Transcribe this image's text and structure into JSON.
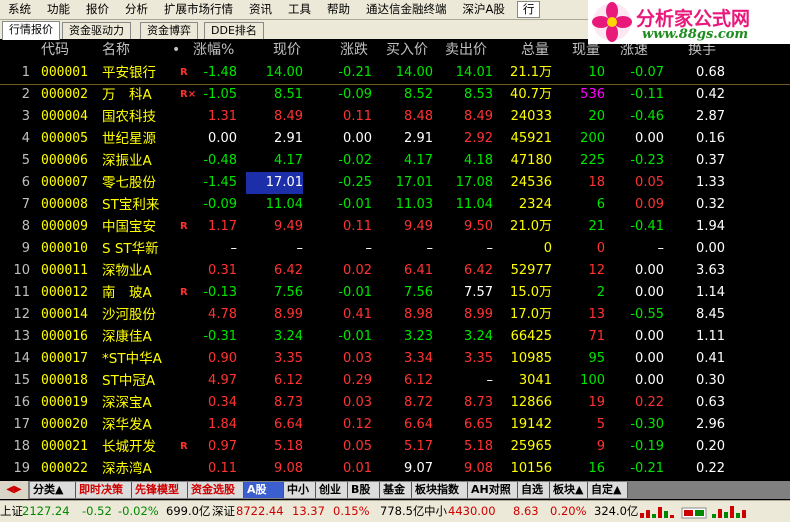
{
  "menu": {
    "items": [
      "系统",
      "功能",
      "报价",
      "分析",
      "扩展市场行情",
      "资讯",
      "工具",
      "帮助",
      "通达信金融终端",
      "深沪A股",
      "行"
    ]
  },
  "logo": {
    "brand": "分析家公式网",
    "url": "www.88gs.com"
  },
  "tabs": [
    "行情报价",
    "资金驱动力",
    "资金博弈",
    "DDE排名"
  ],
  "header": {
    "code": "代码",
    "name": "名称",
    "dot": "•",
    "pct": "涨幅%",
    "price": "现价",
    "chg": "涨跌",
    "bid": "买入价",
    "ask": "卖出价",
    "vol": "总量",
    "cur": "现量",
    "speed": "涨速",
    "turn": "换手"
  },
  "rows": [
    {
      "n": "1",
      "code": "000001",
      "name": "平安银行",
      "flag": "R",
      "pct": "-1.48",
      "price": "14.00",
      "chg": "-0.21",
      "bid": "14.00",
      "ask": "14.01",
      "vol": "21.1万",
      "cur": "10",
      "speed": "-0.07",
      "turn": "0.68",
      "pc": "green",
      "prc": "green",
      "bc": "green",
      "ac": "green",
      "cc": "green",
      "sc": "green"
    },
    {
      "n": "2",
      "code": "000002",
      "name": "万　科A",
      "flag": "R×",
      "pct": "-1.05",
      "price": "8.51",
      "chg": "-0.09",
      "bid": "8.52",
      "ask": "8.53",
      "vol": "40.7万",
      "cur": "536",
      "speed": "-0.11",
      "turn": "0.42",
      "pc": "green",
      "prc": "green",
      "bc": "green",
      "ac": "green",
      "cc": "magenta",
      "sc": "green"
    },
    {
      "n": "3",
      "code": "000004",
      "name": "国农科技",
      "flag": "",
      "pct": "1.31",
      "price": "8.49",
      "chg": "0.11",
      "bid": "8.48",
      "ask": "8.49",
      "vol": "24033",
      "cur": "20",
      "speed": "-0.46",
      "turn": "2.87",
      "pc": "red",
      "prc": "red",
      "bc": "red",
      "ac": "red",
      "cc": "green",
      "sc": "green"
    },
    {
      "n": "4",
      "code": "000005",
      "name": "世纪星源",
      "flag": "",
      "pct": "0.00",
      "price": "2.91",
      "chg": "0.00",
      "bid": "2.91",
      "ask": "2.92",
      "vol": "45921",
      "cur": "200",
      "speed": "0.00",
      "turn": "0.16",
      "pc": "white",
      "prc": "white",
      "bc": "white",
      "ac": "red",
      "cc": "green",
      "sc": "white"
    },
    {
      "n": "5",
      "code": "000006",
      "name": "深振业A",
      "flag": "",
      "pct": "-0.48",
      "price": "4.17",
      "chg": "-0.02",
      "bid": "4.17",
      "ask": "4.18",
      "vol": "47180",
      "cur": "225",
      "speed": "-0.23",
      "turn": "0.37",
      "pc": "green",
      "prc": "green",
      "bc": "green",
      "ac": "green",
      "cc": "green",
      "sc": "green"
    },
    {
      "n": "6",
      "code": "000007",
      "name": "零七股份",
      "flag": "",
      "pct": "-1.45",
      "price": "17.01",
      "chg": "-0.25",
      "bid": "17.01",
      "ask": "17.08",
      "vol": "24536",
      "cur": "18",
      "speed": "0.05",
      "turn": "1.33",
      "pc": "green",
      "prc": "white",
      "bc": "green",
      "ac": "green",
      "cc": "red",
      "sc": "red",
      "hl": true
    },
    {
      "n": "7",
      "code": "000008",
      "name": "ST宝利来",
      "flag": "",
      "pct": "-0.09",
      "price": "11.04",
      "chg": "-0.01",
      "bid": "11.03",
      "ask": "11.04",
      "vol": "2324",
      "cur": "6",
      "speed": "0.09",
      "turn": "0.32",
      "pc": "green",
      "prc": "green",
      "bc": "green",
      "ac": "green",
      "cc": "green",
      "sc": "red"
    },
    {
      "n": "8",
      "code": "000009",
      "name": "中国宝安",
      "flag": "R",
      "pct": "1.17",
      "price": "9.49",
      "chg": "0.11",
      "bid": "9.49",
      "ask": "9.50",
      "vol": "21.0万",
      "cur": "21",
      "speed": "-0.41",
      "turn": "1.94",
      "pc": "red",
      "prc": "red",
      "bc": "red",
      "ac": "red",
      "cc": "green",
      "sc": "green"
    },
    {
      "n": "9",
      "code": "000010",
      "name": "S ST华新",
      "flag": "",
      "pct": "–",
      "price": "–",
      "chg": "–",
      "bid": "–",
      "ask": "–",
      "vol": "0",
      "cur": "0",
      "speed": "–",
      "turn": "0.00",
      "pc": "white",
      "prc": "white",
      "bc": "white",
      "ac": "white",
      "cc": "red",
      "sc": "white"
    },
    {
      "n": "10",
      "code": "000011",
      "name": "深物业A",
      "flag": "",
      "pct": "0.31",
      "price": "6.42",
      "chg": "0.02",
      "bid": "6.41",
      "ask": "6.42",
      "vol": "52977",
      "cur": "12",
      "speed": "0.00",
      "turn": "3.63",
      "pc": "red",
      "prc": "red",
      "bc": "red",
      "ac": "red",
      "cc": "red",
      "sc": "white"
    },
    {
      "n": "11",
      "code": "000012",
      "name": "南　玻A",
      "flag": "R",
      "pct": "-0.13",
      "price": "7.56",
      "chg": "-0.01",
      "bid": "7.56",
      "ask": "7.57",
      "vol": "15.0万",
      "cur": "2",
      "speed": "0.00",
      "turn": "1.14",
      "pc": "green",
      "prc": "green",
      "bc": "green",
      "ac": "white",
      "cc": "green",
      "sc": "white"
    },
    {
      "n": "12",
      "code": "000014",
      "name": "沙河股份",
      "flag": "",
      "pct": "4.78",
      "price": "8.99",
      "chg": "0.41",
      "bid": "8.98",
      "ask": "8.99",
      "vol": "17.0万",
      "cur": "13",
      "speed": "-0.55",
      "turn": "8.45",
      "pc": "red",
      "prc": "red",
      "bc": "red",
      "ac": "red",
      "cc": "red",
      "sc": "green"
    },
    {
      "n": "13",
      "code": "000016",
      "name": "深康佳A",
      "flag": "",
      "pct": "-0.31",
      "price": "3.24",
      "chg": "-0.01",
      "bid": "3.23",
      "ask": "3.24",
      "vol": "66425",
      "cur": "71",
      "speed": "0.00",
      "turn": "1.11",
      "pc": "green",
      "prc": "green",
      "bc": "green",
      "ac": "green",
      "cc": "red",
      "sc": "white"
    },
    {
      "n": "14",
      "code": "000017",
      "name": "*ST中华A",
      "flag": "",
      "pct": "0.90",
      "price": "3.35",
      "chg": "0.03",
      "bid": "3.34",
      "ask": "3.35",
      "vol": "10985",
      "cur": "95",
      "speed": "0.00",
      "turn": "0.41",
      "pc": "red",
      "prc": "red",
      "bc": "red",
      "ac": "red",
      "cc": "green",
      "sc": "white"
    },
    {
      "n": "15",
      "code": "000018",
      "name": "ST中冠A",
      "flag": "",
      "pct": "4.97",
      "price": "6.12",
      "chg": "0.29",
      "bid": "6.12",
      "ask": "–",
      "vol": "3041",
      "cur": "100",
      "speed": "0.00",
      "turn": "0.30",
      "pc": "red",
      "prc": "red",
      "bc": "red",
      "ac": "white",
      "cc": "green",
      "sc": "white"
    },
    {
      "n": "16",
      "code": "000019",
      "name": "深深宝A",
      "flag": "",
      "pct": "0.34",
      "price": "8.73",
      "chg": "0.03",
      "bid": "8.72",
      "ask": "8.73",
      "vol": "12866",
      "cur": "19",
      "speed": "0.22",
      "turn": "0.63",
      "pc": "red",
      "prc": "red",
      "bc": "red",
      "ac": "red",
      "cc": "red",
      "sc": "red"
    },
    {
      "n": "17",
      "code": "000020",
      "name": "深华发A",
      "flag": "",
      "pct": "1.84",
      "price": "6.64",
      "chg": "0.12",
      "bid": "6.64",
      "ask": "6.65",
      "vol": "19142",
      "cur": "5",
      "speed": "-0.30",
      "turn": "2.96",
      "pc": "red",
      "prc": "red",
      "bc": "red",
      "ac": "red",
      "cc": "red",
      "sc": "green"
    },
    {
      "n": "18",
      "code": "000021",
      "name": "长城开发",
      "flag": "R",
      "pct": "0.97",
      "price": "5.18",
      "chg": "0.05",
      "bid": "5.17",
      "ask": "5.18",
      "vol": "25965",
      "cur": "9",
      "speed": "-0.19",
      "turn": "0.20",
      "pc": "red",
      "prc": "red",
      "bc": "red",
      "ac": "red",
      "cc": "red",
      "sc": "green"
    },
    {
      "n": "19",
      "code": "000022",
      "name": "深赤湾A",
      "flag": "",
      "pct": "0.11",
      "price": "9.08",
      "chg": "0.01",
      "bid": "9.07",
      "ask": "9.08",
      "vol": "10156",
      "cur": "16",
      "speed": "-0.21",
      "turn": "0.22",
      "pc": "red",
      "prc": "red",
      "bc": "white",
      "ac": "red",
      "cc": "green",
      "sc": "green"
    }
  ],
  "bottom_tabs": [
    {
      "label": "分类▲",
      "style": ""
    },
    {
      "label": "即时决策",
      "style": "redtxt"
    },
    {
      "label": "先锋模型",
      "style": "redtxt"
    },
    {
      "label": "资金选股",
      "style": "redtxt"
    },
    {
      "label": "A股",
      "style": "active"
    },
    {
      "label": "中小",
      "style": ""
    },
    {
      "label": "创业",
      "style": ""
    },
    {
      "label": "B股",
      "style": ""
    },
    {
      "label": "基金",
      "style": ""
    },
    {
      "label": "板块指数",
      "style": ""
    },
    {
      "label": "AH对照",
      "style": ""
    },
    {
      "label": "自选",
      "style": ""
    },
    {
      "label": "板块▲",
      "style": ""
    },
    {
      "label": "自定▲",
      "style": ""
    }
  ],
  "status": {
    "sh_label": "上证",
    "sh_val": "2127.24",
    "sh_chg": "-0.52",
    "sh_pct": "-0.02%",
    "sh_amt": "699.0亿",
    "sz_label": "深证",
    "sz_val": "8722.44",
    "sz_chg": "13.37",
    "sz_pct": "0.15%",
    "sz_amt": "778.5亿",
    "zx_label": "中小",
    "zx_val": "4430.00",
    "zx_chg": "8.63",
    "zx_pct": "0.20%",
    "zx_amt": "324.0亿"
  },
  "colors": {
    "up": "#ff3333",
    "down": "#00e600",
    "flat": "#ffffff",
    "code": "#ffff00",
    "highlight": "#1c2fa8"
  }
}
